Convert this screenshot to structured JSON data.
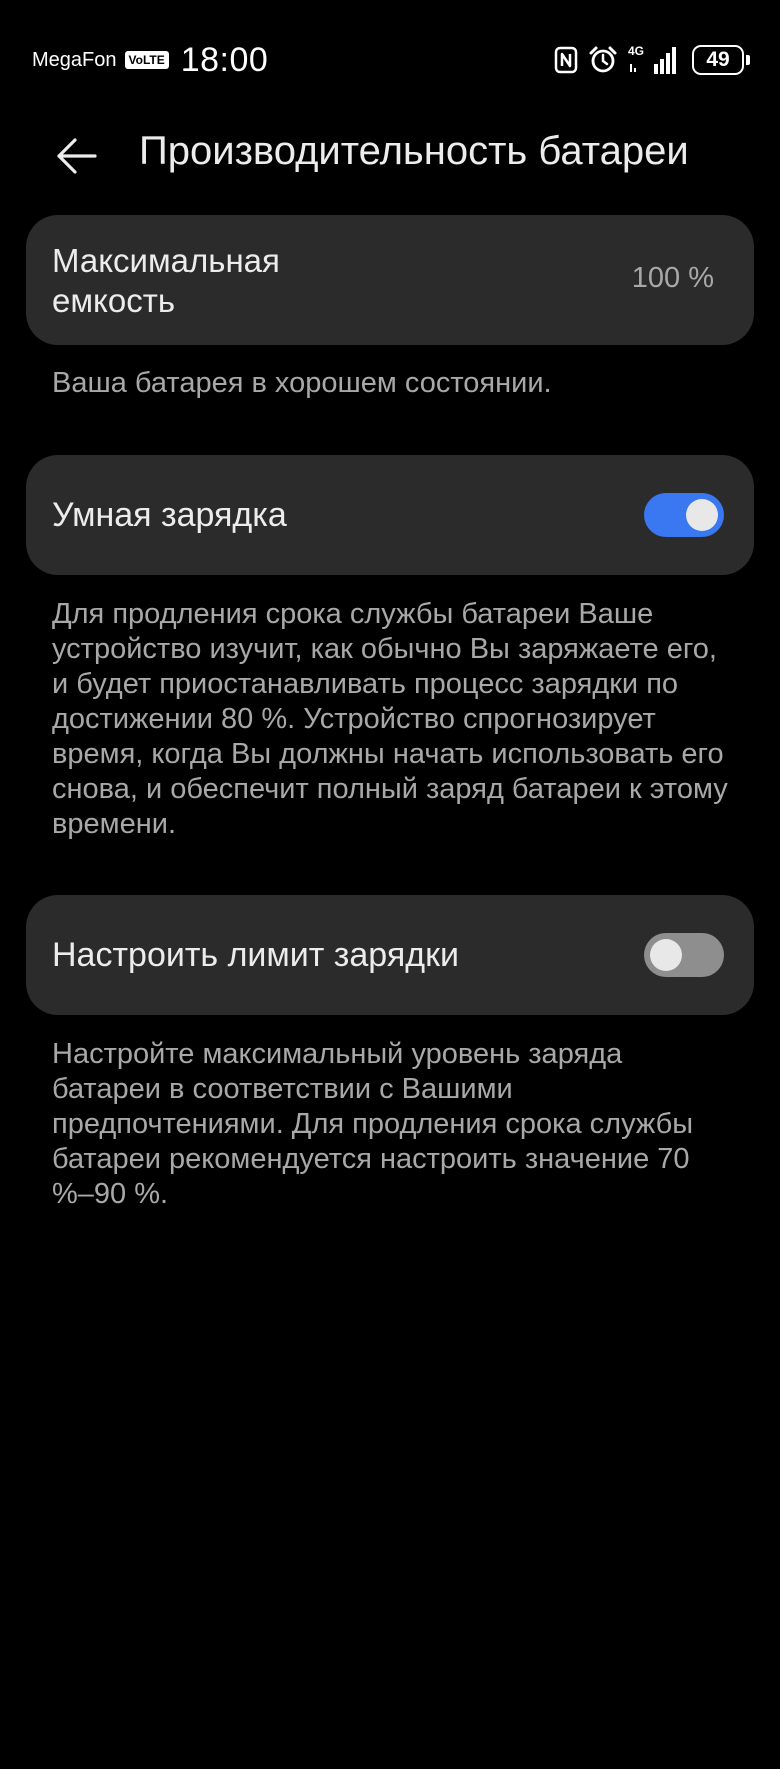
{
  "status_bar": {
    "carrier": "MegaFon",
    "volte_badge": "VoLTE",
    "time": "18:00",
    "network": "4G",
    "battery_percent": "49",
    "icons": [
      "nfc-icon",
      "alarm-icon",
      "signal-icon",
      "battery-icon"
    ]
  },
  "header": {
    "title": "Производительность батареи",
    "back_icon": "arrow-left-icon"
  },
  "capacity": {
    "label": "Максимальная емкость",
    "value": "100 %",
    "description": "Ваша батарея в хорошем состоянии."
  },
  "smart_charging": {
    "label": "Умная зарядка",
    "enabled": true,
    "description": "Для продления срока службы батареи Ваше устройство изучит, как обычно Вы заряжаете его, и будет приостанавливать процесс зарядки по достижении 80 %. Устройство спрогнозирует время, когда Вы должны начать использовать его снова, и обеспечит полный заряд батареи к этому времени."
  },
  "charge_limit": {
    "label": "Настроить лимит зарядки",
    "enabled": false,
    "description": "Настройте максимальный уровень заряда батареи в соответствии с Вашими предпочтениями. Для продления срока службы батареи рекомендуется настроить значение 70 %–90 %."
  },
  "colors": {
    "background": "#000000",
    "card": "#2b2b2b",
    "toggle_on": "#3a78f2",
    "toggle_off": "#8e8e8e",
    "primary_text": "#ececec",
    "secondary_text": "#a8a8a8"
  }
}
